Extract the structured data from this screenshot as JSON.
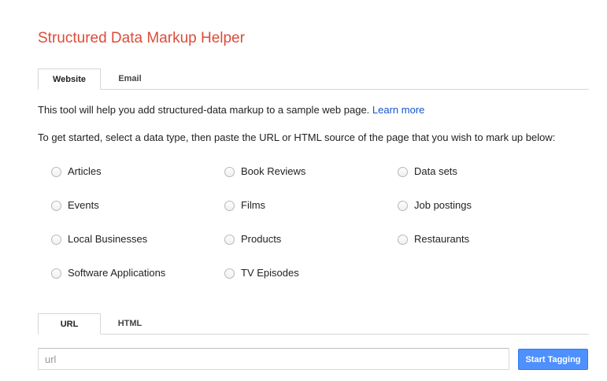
{
  "header": {
    "title": "Structured Data Markup Helper"
  },
  "source_tabs": [
    {
      "label": "Website",
      "active": true
    },
    {
      "label": "Email",
      "active": false
    }
  ],
  "intro": {
    "text": "This tool will help you add structured-data markup to a sample web page. ",
    "link": "Learn more"
  },
  "instructions": "To get started, select a data type, then paste the URL or HTML source of the page that you wish to mark up below:",
  "data_types": [
    {
      "label": "Articles",
      "selected": false
    },
    {
      "label": "Book Reviews",
      "selected": false
    },
    {
      "label": "Data sets",
      "selected": false
    },
    {
      "label": "Events",
      "selected": false
    },
    {
      "label": "Films",
      "selected": false
    },
    {
      "label": "Job postings",
      "selected": false
    },
    {
      "label": "Local Businesses",
      "selected": false
    },
    {
      "label": "Products",
      "selected": false
    },
    {
      "label": "Restaurants",
      "selected": false
    },
    {
      "label": "Software Applications",
      "selected": false
    },
    {
      "label": "TV Episodes",
      "selected": false
    }
  ],
  "input_tabs": [
    {
      "label": "URL",
      "active": true
    },
    {
      "label": "HTML",
      "active": false
    }
  ],
  "url_input": {
    "value": "",
    "placeholder": "url"
  },
  "start_button": {
    "label": "Start Tagging"
  },
  "colors": {
    "title": "#dd4b39",
    "link": "#1155cc",
    "button": "#4d90fe"
  }
}
